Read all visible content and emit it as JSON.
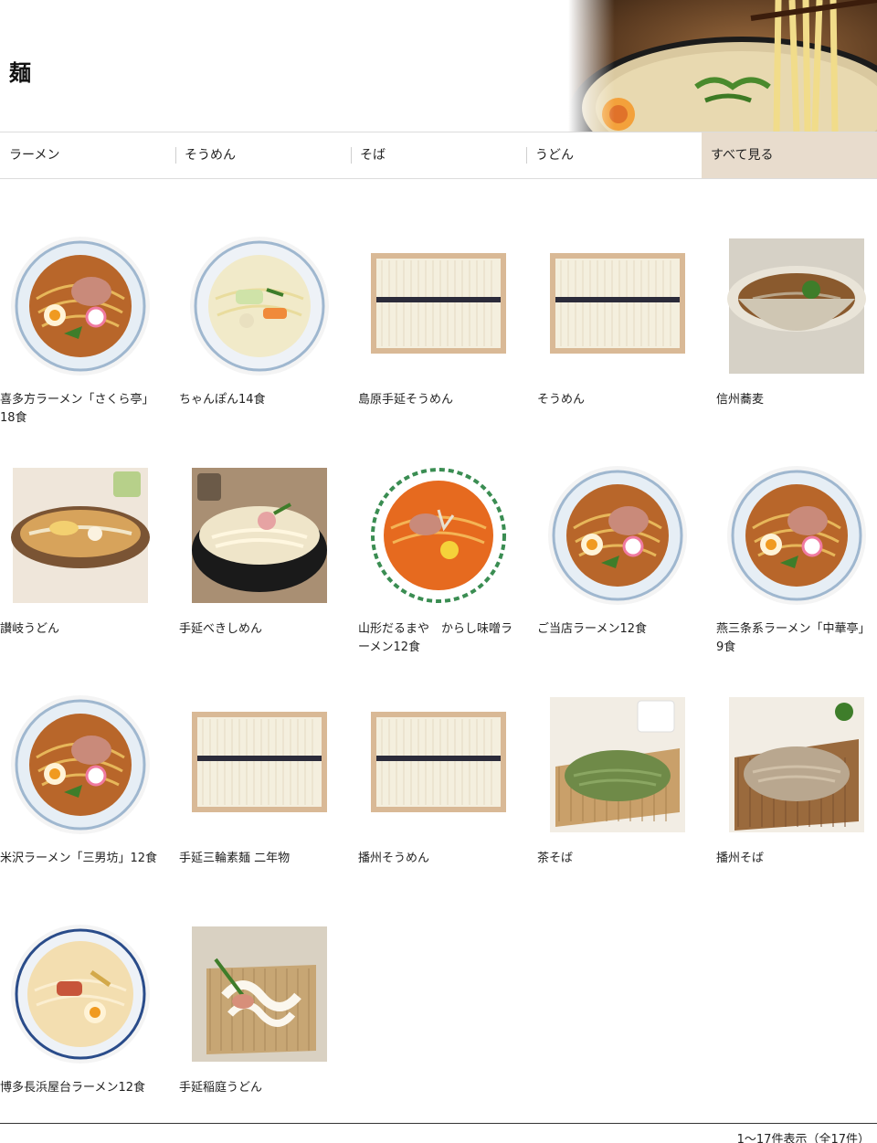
{
  "header": {
    "title": "麺"
  },
  "nav": {
    "items": [
      {
        "label": "ラーメン"
      },
      {
        "label": "そうめん"
      },
      {
        "label": "そば"
      },
      {
        "label": "うどん"
      },
      {
        "label": "すべて見る"
      }
    ]
  },
  "products": [
    {
      "title": "喜多方ラーメン「さくら亭」18食",
      "image": "ramen-bowl"
    },
    {
      "title": "ちゃんぽん14食",
      "image": "champon-bowl"
    },
    {
      "title": "島原手延そうめん",
      "image": "somen-box"
    },
    {
      "title": "そうめん",
      "image": "somen-box"
    },
    {
      "title": "信州蕎麦",
      "image": "soba-bowl"
    },
    {
      "title": "讃岐うどん",
      "image": "udon-bowl"
    },
    {
      "title": "手延べきしめん",
      "image": "kishimen-bowl"
    },
    {
      "title": "山形だるまや　からし味噌ラーメン12食",
      "image": "miso-ramen-bowl"
    },
    {
      "title": "ご当店ラーメン12食",
      "image": "ramen-bowl"
    },
    {
      "title": "燕三条系ラーメン「中華亭」9食",
      "image": "ramen-bowl"
    },
    {
      "title": "米沢ラーメン「三男坊」12食",
      "image": "ramen-bowl"
    },
    {
      "title": "手延三輪素麺 二年物",
      "image": "somen-box"
    },
    {
      "title": "播州そうめん",
      "image": "somen-box"
    },
    {
      "title": "茶そば",
      "image": "cha-soba"
    },
    {
      "title": "播州そば",
      "image": "zaru-soba"
    },
    {
      "title": "博多長浜屋台ラーメン12食",
      "image": "tonkotsu-bowl"
    },
    {
      "title": "手延稲庭うどん",
      "image": "inaniwa-udon"
    }
  ],
  "footer": {
    "result_count": "1～17件表示（全17件）"
  }
}
